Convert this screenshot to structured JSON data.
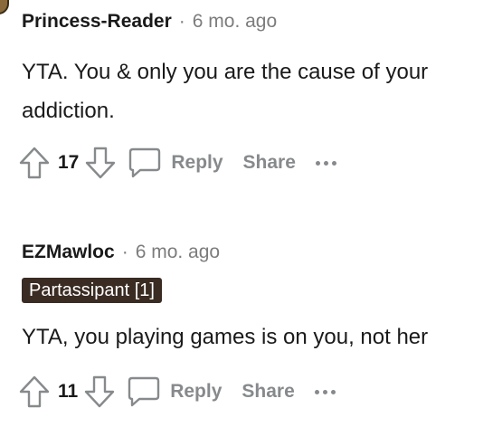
{
  "comments": [
    {
      "author": "Princess-Reader",
      "separator": "·",
      "time": "6 mo. ago",
      "flair": "",
      "body_lines": [
        "YTA. You & only you are the cause of your",
        "addiction."
      ],
      "score": "17",
      "reply_label": "Reply",
      "share_label": "Share"
    },
    {
      "author": "EZMawloc",
      "separator": "·",
      "time": "6 mo. ago",
      "flair": "Partassipant [1]",
      "body_lines": [
        "YTA, you playing games is on you, not her"
      ],
      "score": "11",
      "reply_label": "Reply",
      "share_label": "Share"
    }
  ],
  "icons": {
    "upvote": "arrow-up-outline-icon",
    "downvote": "arrow-down-outline-icon",
    "reply": "speech-bubble-icon",
    "more": "ellipsis-icon"
  },
  "colors": {
    "text": "#1a1a1b",
    "muted": "#878a8c",
    "flair_bg": "#3a2c23"
  }
}
